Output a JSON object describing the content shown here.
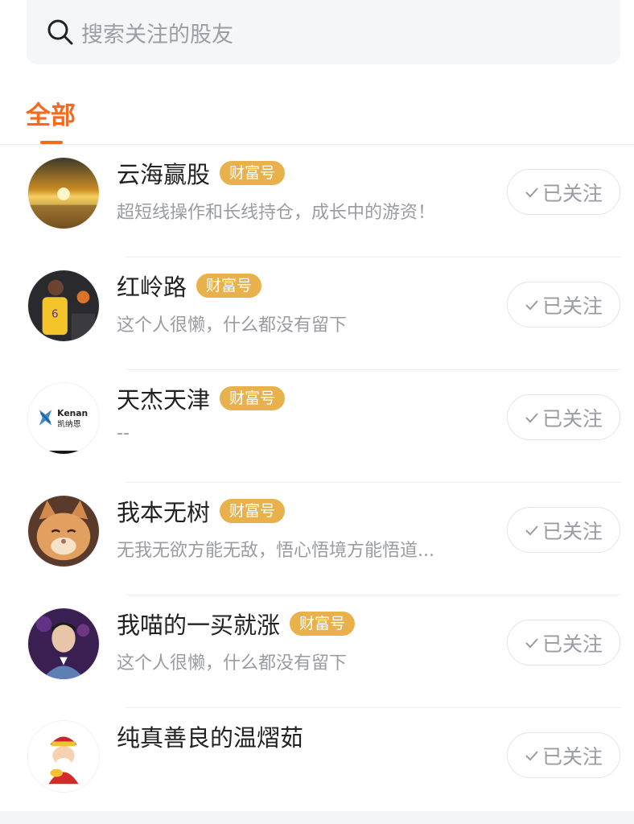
{
  "search": {
    "placeholder": "搜索关注的股友",
    "icon": "search-icon"
  },
  "tabs": [
    {
      "label": "全部",
      "active": true
    }
  ],
  "accent_color": "#f56a1d",
  "badge_color": "#e9b14c",
  "users": [
    {
      "name": "云海赢股",
      "badge": "财富号",
      "desc": "超短线操作和长线持仓，成长中的游资！",
      "button": "已关注",
      "avatar": "sunset-avatar"
    },
    {
      "name": "红岭路",
      "badge": "财富号",
      "desc": "这个人很懒，什么都没有留下",
      "button": "已关注",
      "avatar": "basketball-player-avatar"
    },
    {
      "name": "天杰天津",
      "badge": "财富号",
      "desc": "--",
      "button": "已关注",
      "avatar": "kenan-logo-avatar",
      "logo_text_top": "Kenan",
      "logo_text_bottom": "凯纳恩"
    },
    {
      "name": "我本无树",
      "badge": "财富号",
      "desc": "无我无欲方能无敌，悟心悟境方能悟道...",
      "button": "已关注",
      "avatar": "kitten-avatar"
    },
    {
      "name": "我喵的一买就涨",
      "badge": "财富号",
      "desc": "这个人很懒，什么都没有留下",
      "button": "已关注",
      "avatar": "person-avatar"
    },
    {
      "name": "纯真善良的温熠茹",
      "badge": "",
      "desc": "",
      "button": "已关注",
      "avatar": "fortune-god-avatar"
    }
  ]
}
